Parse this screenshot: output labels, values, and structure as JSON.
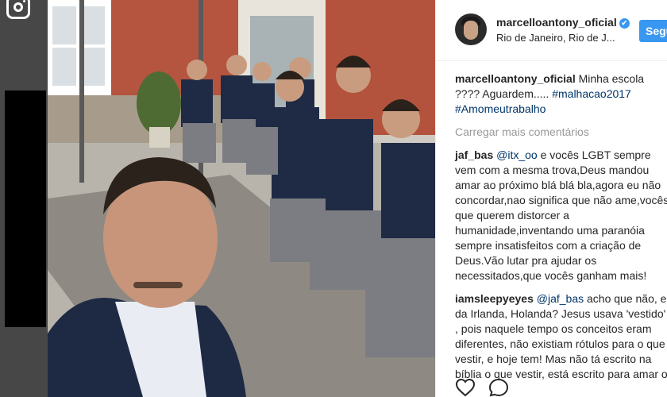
{
  "post": {
    "username": "marcelloantony_oficial",
    "verified_badge": "✔",
    "location": "Rio de Janeiro, Rio de J...",
    "follow_label": "Segu"
  },
  "caption": {
    "username": "marcelloantony_oficial",
    "text": " Minha escola ???? Aguardem..... ",
    "hashtag1": "#malhacao2017",
    "hashtag2": "#Amomeutrabalho"
  },
  "load_more": "Carregar mais comentários",
  "comments": [
    {
      "username": "jaf_bas",
      "mention": "@itx_oo",
      "text": " e vocês LGBT sempre vem com a mesma trova,Deus mandou amar ao próximo blá blá bla,agora eu não concordar,nao significa que não ame,vocês que querem distorcer a humanidade,inventando uma paranóia sempre insatisfeitos com a criação de Deus.Vão lutar pra ajudar os necessitados,que vocês ganham mais!"
    },
    {
      "username": "iamsleepyeyes",
      "mention": "@jaf_bas",
      "text": " acho que não, e da Irlanda, Holanda? Jesus usava 'vestido' , pois naquele tempo os conceitos eram diferentes, não existiam rótulos para o que vestir, e hoje tem! Mas não tá escrito na bíblia o que vestir, está escrito para amar o"
    }
  ],
  "icons": {
    "instagram": "instagram-icon",
    "like": "heart-icon",
    "comment": "comment-icon"
  },
  "colors": {
    "accent": "#3897f0",
    "link": "#003569",
    "muted": "#999999",
    "text": "#262626"
  }
}
